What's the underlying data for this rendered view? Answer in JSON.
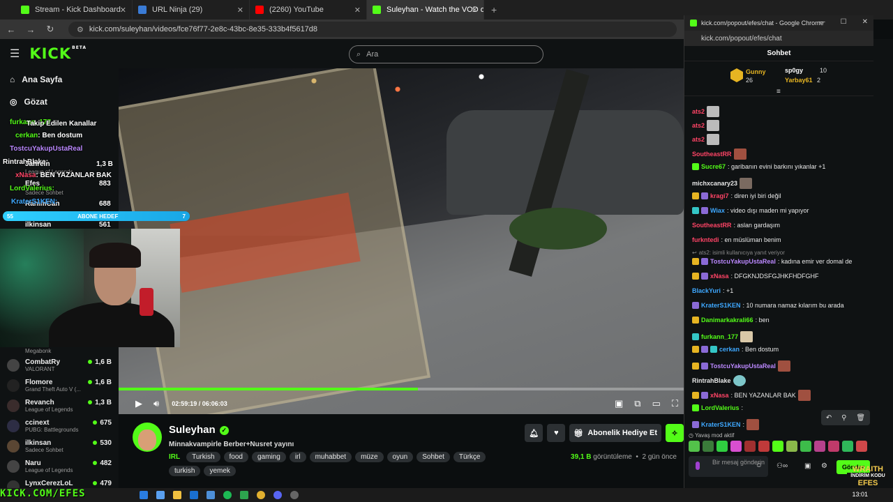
{
  "browser": {
    "tabs": [
      {
        "title": "Stream - Kick Dashboard",
        "color": "#53fc18"
      },
      {
        "title": "URL Ninja (29)",
        "color": "#3a7bd5"
      },
      {
        "title": "(2260) YouTube",
        "color": "#ff0000"
      },
      {
        "title": "Suleyhan - Watch the VOD on K",
        "color": "#53fc18"
      }
    ],
    "url": "kick.com/suleyhan/videos/fce76f77-2e8c-43bc-8e35-333b4f5617d8"
  },
  "kick": {
    "logo": "KICK",
    "logo_beta": "BETA",
    "search_placeholder": "Ara",
    "nav": {
      "home": "Ana Sayfa",
      "browse": "Gözat"
    },
    "channels": [
      {
        "name": "CombatRy",
        "game": "VALORANT",
        "viewers": "1,6 B",
        "color": "#444"
      },
      {
        "name": "Flomore",
        "game": "Grand Theft Auto V (...",
        "viewers": "1,6 B",
        "color": "#222"
      },
      {
        "name": "Revanch",
        "game": "League of Legends",
        "viewers": "1,3 B",
        "color": "#3a2c2c"
      },
      {
        "name": "ccinext",
        "game": "PUBG: Battlegrounds",
        "viewers": "675",
        "color": "#2d2d44"
      },
      {
        "name": "ilkinsan",
        "game": "Sadece Sohbet",
        "viewers": "530",
        "color": "#5a4633"
      },
      {
        "name": "Naru",
        "game": "League of Legends",
        "viewers": "482",
        "color": "#444"
      },
      {
        "name": "LynxCerezLoL",
        "game": "",
        "viewers": "479",
        "color": "#333"
      }
    ],
    "megabonk": "Megabonk",
    "overlay_rows": [
      {
        "user": "furkann_177",
        "text": "Takip Edilen Kanallar",
        "color": "#53fc18"
      },
      {
        "user": "cerkan",
        "text": ": Ben dostum",
        "color": "#53fc18"
      },
      {
        "user": "TostcuYakupUstaReal",
        "text": "",
        "color": "#bb88ff"
      },
      {
        "user": "RintrahBlake",
        "text": ":",
        "color": "#ffffff"
      },
      {
        "user": "xNasa",
        "text": ": BEN YAZANLAR BAK",
        "color": "#ff4466"
      },
      {
        "user": "LordValerius",
        "text": ":",
        "color": "#53fc18"
      },
      {
        "user": "KraterS1KEN",
        "text": ":",
        "color": "#3ea8ff"
      }
    ],
    "overlay_side": [
      {
        "name": "Jahrein",
        "viewers": "1,3 B"
      },
      {
        "name": "Efes",
        "viewers": "883"
      },
      {
        "name": "RahimCan",
        "viewers": "688"
      },
      {
        "name": "ilkinsan",
        "viewers": "561"
      }
    ],
    "overlay_meta": {
      "lol": "League of Legends",
      "chat": "Sadece Sohbet"
    },
    "goal": {
      "left": "55",
      "label": "ABONE HEDEF",
      "right": "7",
      "progress": 1.0
    },
    "player": {
      "current": "02:59:19",
      "total": "06:06:03",
      "progress": 0.53
    },
    "streamer": {
      "name": "Suleyhan",
      "title": "Minnakvampirle Berber+Nusret yayını",
      "category": "IRL",
      "tags": [
        "Turkish",
        "food",
        "gaming",
        "irl",
        "muhabbet",
        "müze",
        "oyun",
        "Sohbet",
        "Türkçe",
        "turkish",
        "yemek"
      ],
      "views": "39,1 B",
      "views_label": "görüntüleme",
      "age": "2 gün önce",
      "gift_label": "Abonelik Hediye Et"
    }
  },
  "popup": {
    "window_title": "kick.com/popout/efes/chat - Google Chrome",
    "url": "kick.com/popout/efes/chat",
    "chat_title": "Sohbet",
    "top_gifters": [
      {
        "name": "Gunny",
        "count": "26",
        "color": "#e6b422"
      },
      {
        "name": "sp0gy",
        "count": "10",
        "color": "#ffffff"
      },
      {
        "name": "Yarbay61",
        "count": "2",
        "color": "#e6b422"
      }
    ],
    "reply_hint": "ats2: isimli kullanıcıya yanıt veriyor",
    "messages": [
      {
        "user": "ats2",
        "text": "",
        "color": "#ff4466"
      },
      {
        "user": "ats2",
        "text": "",
        "color": "#ff4466"
      },
      {
        "user": "ats2",
        "text": "",
        "color": "#ff4466"
      },
      {
        "user": "SoutheastRR",
        "text": "",
        "color": "#ff4466"
      },
      {
        "user": "Sucre67",
        "text": ": garibanın evini barkını yıkanlar +1",
        "color": "#53fc18"
      },
      {
        "user": "michxcanary23",
        "text": ":",
        "color": "#ffffff"
      },
      {
        "user": "kragi7",
        "text": ": diren iyi biri değil",
        "color": "#ff4466"
      },
      {
        "user": "Wiax",
        "text": ": video dışı maden mi yapıyor",
        "color": "#3ea8ff"
      },
      {
        "user": "SoutheastRR",
        "text": ": aslan gardaşım",
        "color": "#ff4466"
      },
      {
        "user": "furkntedi",
        "text": ": en müslüman benim",
        "color": "#ff4466"
      },
      {
        "user": "TostcuYakupUstaReal",
        "text": ": kadına emir ver domal de",
        "color": "#bb88ff"
      },
      {
        "user": "xNasa",
        "text": ": DFGKNJDSFGJHKFHDFGHF",
        "color": "#ff4466"
      },
      {
        "user": "BlackYuri",
        "text": ": +1",
        "color": "#3ea8ff"
      },
      {
        "user": "KraterS1KEN",
        "text": ": 10 numara namaz kılarım bu arada",
        "color": "#3ea8ff"
      },
      {
        "user": "Danimarkakrali66",
        "text": ": ben",
        "color": "#53fc18"
      },
      {
        "user": "furkann_177",
        "text": ":",
        "color": "#53fc18"
      },
      {
        "user": "cerkan",
        "text": ": Ben dostum",
        "color": "#3ea8ff"
      },
      {
        "user": "TostcuYakupUstaReal",
        "text": ":",
        "color": "#bb88ff"
      },
      {
        "user": "RintrahBlake",
        "text": ":",
        "color": "#ffffff"
      },
      {
        "user": "xNasa",
        "text": ": BEN YAZANLAR BAK",
        "color": "#ff4466"
      },
      {
        "user": "LordValerius",
        "text": ":",
        "color": "#53fc18"
      },
      {
        "user": "KraterS1KEN",
        "text": ":",
        "color": "#3ea8ff"
      }
    ],
    "slow_mode": "Yavaş mod aktif",
    "input_placeholder": "Bir mesaj gönderin",
    "send_label": "Gönder"
  },
  "overlay_brand": {
    "url": "KICK.COM/EFES",
    "wraith": "WRAITH",
    "promo": "İNDİRİM KODU",
    "code": "EFES"
  },
  "taskbar": {
    "time": "13:01"
  },
  "colors": {
    "accent": "#53fc18",
    "bg": "#0b0e0f"
  }
}
